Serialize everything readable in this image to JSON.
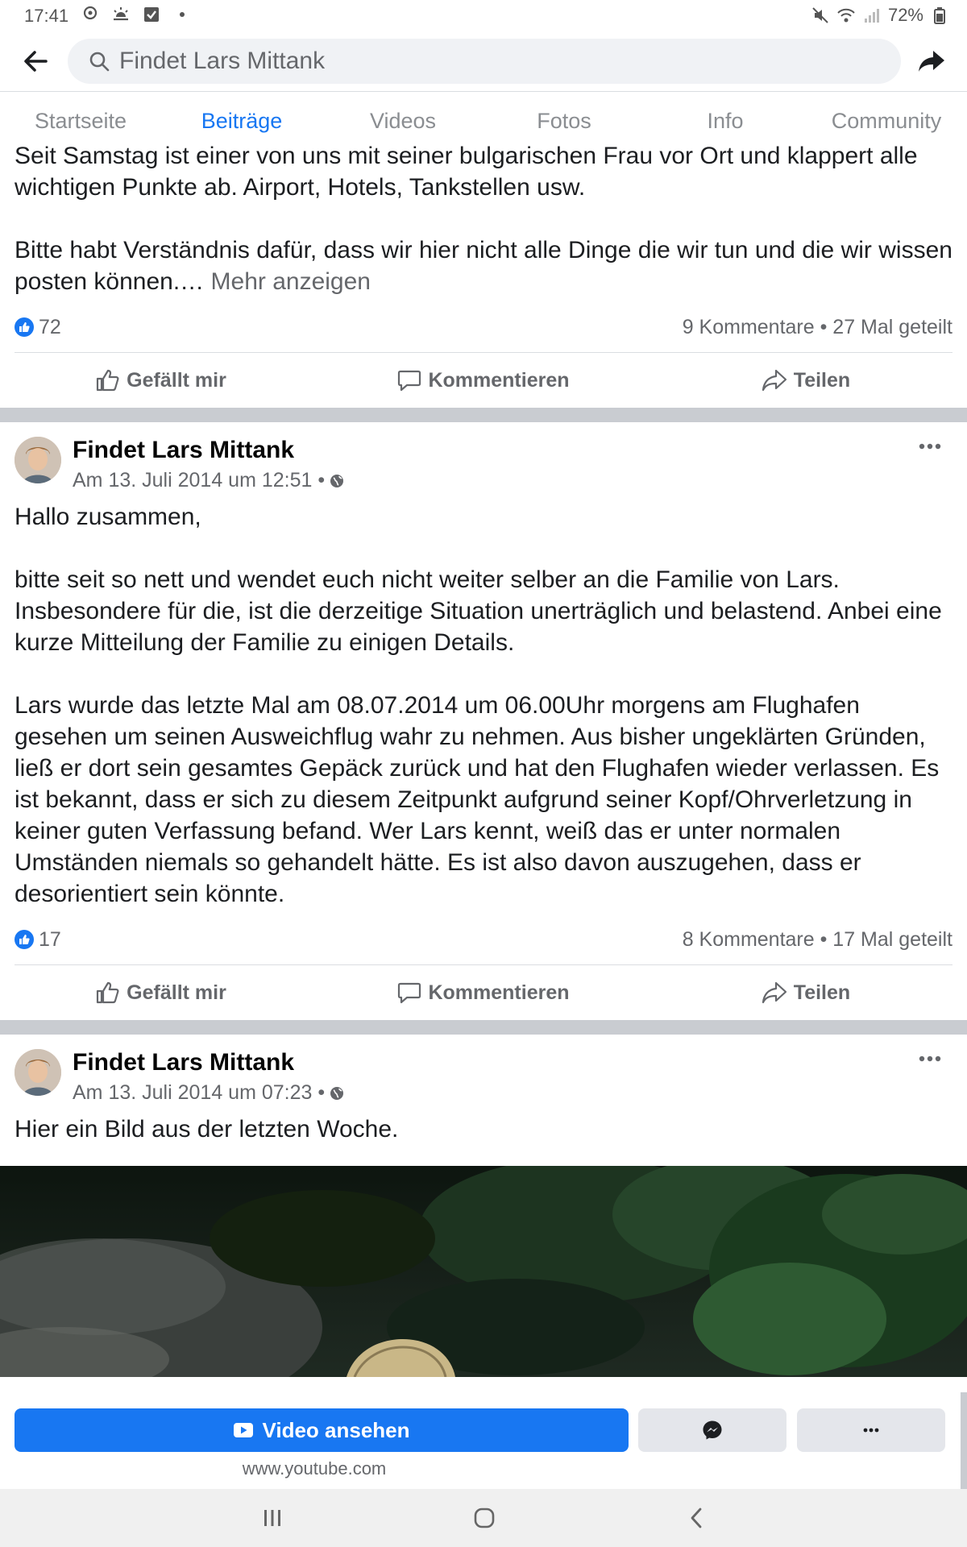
{
  "status_bar": {
    "time": "17:41",
    "battery": "72%"
  },
  "search": {
    "value": "Findet Lars Mittank"
  },
  "tabs": [
    {
      "label": "Startseite",
      "active": false
    },
    {
      "label": "Beiträge",
      "active": true
    },
    {
      "label": "Videos",
      "active": false
    },
    {
      "label": "Fotos",
      "active": false
    },
    {
      "label": "Info",
      "active": false
    },
    {
      "label": "Community",
      "active": false
    }
  ],
  "posts": [
    {
      "paragraphs": [
        "Seit Samstag ist einer von uns mit seiner bulgarischen Frau vor Ort und klappert alle wichtigen Punkte ab. Airport, Hotels, Tankstellen usw.",
        "Bitte habt Verständnis dafür, dass wir hier nicht alle Dinge die wir tun und die wir wissen posten können.…"
      ],
      "more_label": "Mehr anzeigen",
      "likes": "72",
      "stats": "9 Kommentare • 27 Mal geteilt"
    },
    {
      "author": "Findet Lars Mittank",
      "time": "Am 13. Juli 2014 um 12:51 •",
      "paragraphs": [
        "Hallo zusammen,",
        "bitte seit so nett und wendet euch nicht weiter selber an die Familie von Lars. Insbesondere für die, ist die derzeitige Situation unerträglich und belastend. Anbei eine kurze Mitteilung der Familie zu einigen Details.",
        "Lars wurde das letzte Mal am 08.07.2014 um 06.00Uhr morgens am Flughafen gesehen um seinen Ausweichflug wahr zu nehmen. Aus bisher ungeklärten Gründen, ließ er dort sein gesamtes Gepäck zurück und hat den Flughafen wieder verlassen. Es ist bekannt, dass er sich zu diesem Zeitpunkt aufgrund seiner Kopf/Ohrverletzung in keiner guten Verfassung befand. Wer Lars kennt, weiß das er unter normalen Umständen niemals so gehandelt hätte. Es ist also davon auszugehen, dass er desorientiert sein könnte."
      ],
      "likes": "17",
      "stats": "8 Kommentare • 17 Mal geteilt"
    },
    {
      "author": "Findet Lars Mittank",
      "time": "Am 13. Juli 2014 um 07:23 •",
      "paragraphs": [
        "Hier ein Bild aus der letzten Woche."
      ]
    }
  ],
  "actions": {
    "like": "Gefällt mir",
    "comment": "Kommentieren",
    "share": "Teilen"
  },
  "ad": {
    "button_label": "Video ansehen",
    "url": "www.youtube.com"
  },
  "colors": {
    "accent": "#1877f2",
    "text": "#1c1e21",
    "muted": "#65676b",
    "separator": "#c9ccd1"
  },
  "icons": [
    "back-arrow-icon",
    "search-icon",
    "share-arrow-icon",
    "like-badge-icon",
    "thumbs-up-icon",
    "comment-icon",
    "share-icon",
    "globe-icon",
    "more-dots-icon",
    "youtube-play-icon",
    "messenger-icon",
    "nav-recents-icon",
    "nav-home-icon",
    "nav-back-icon"
  ]
}
